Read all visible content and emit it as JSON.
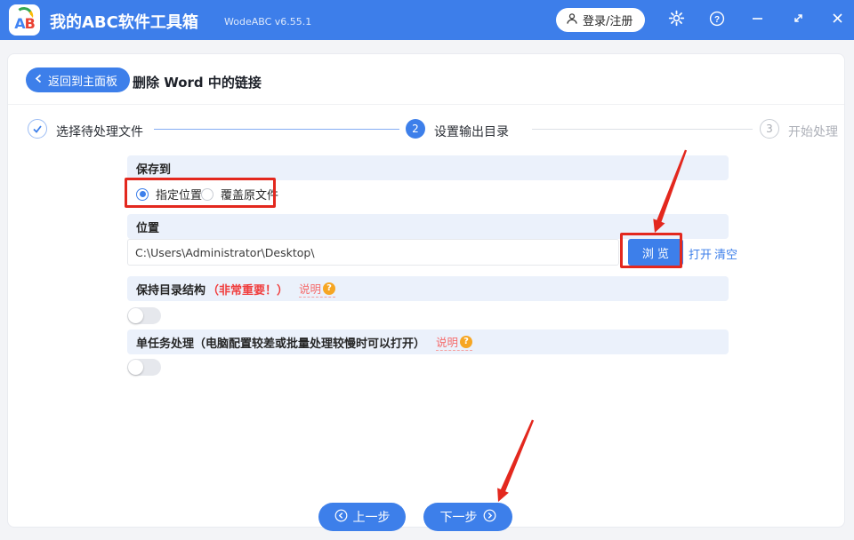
{
  "colors": {
    "titlebar_blue": "#3D7EEA",
    "accent_blue": "#3D7FEA",
    "section_header_bg": "#EBF1FB",
    "annotation_red": "#E3281E",
    "important_red": "#F03E3E",
    "help_link_pink": "#F56C6C",
    "badge_orange": "#F6A623"
  },
  "titlebar": {
    "logo_a": "A",
    "logo_b": "B",
    "app_title": "我的ABC软件工具箱",
    "version": "WodeABC v6.55.1",
    "login_label": "登录/注册"
  },
  "header": {
    "back_label": "返回到主面板",
    "page_title": "删除 Word 中的链接"
  },
  "steps": {
    "step1_label": "选择待处理文件",
    "step2_num": "2",
    "step2_label": "设置输出目录",
    "step3_num": "3",
    "step3_label": "开始处理"
  },
  "form": {
    "save_to": {
      "header": "保存到",
      "radio_specified": "指定位置",
      "radio_overwrite": "覆盖原文件",
      "selected": "指定位置"
    },
    "location": {
      "header": "位置",
      "path_value": "C:\\Users\\Administrator\\Desktop\\",
      "browse_label": "浏 览",
      "open_label": "打开",
      "clear_label": "清空"
    },
    "keep_structure": {
      "title": "保持目录结构",
      "important_note": "（非常重要！）",
      "help_label": "说明",
      "help_glyph": "?",
      "toggle_state": "off"
    },
    "single_task": {
      "title": "单任务处理（电脑配置较差或批量处理较慢时可以打开）",
      "help_label": "说明",
      "help_glyph": "?",
      "toggle_state": "off"
    }
  },
  "footer": {
    "prev_label": "上一步",
    "next_label": "下一步"
  }
}
